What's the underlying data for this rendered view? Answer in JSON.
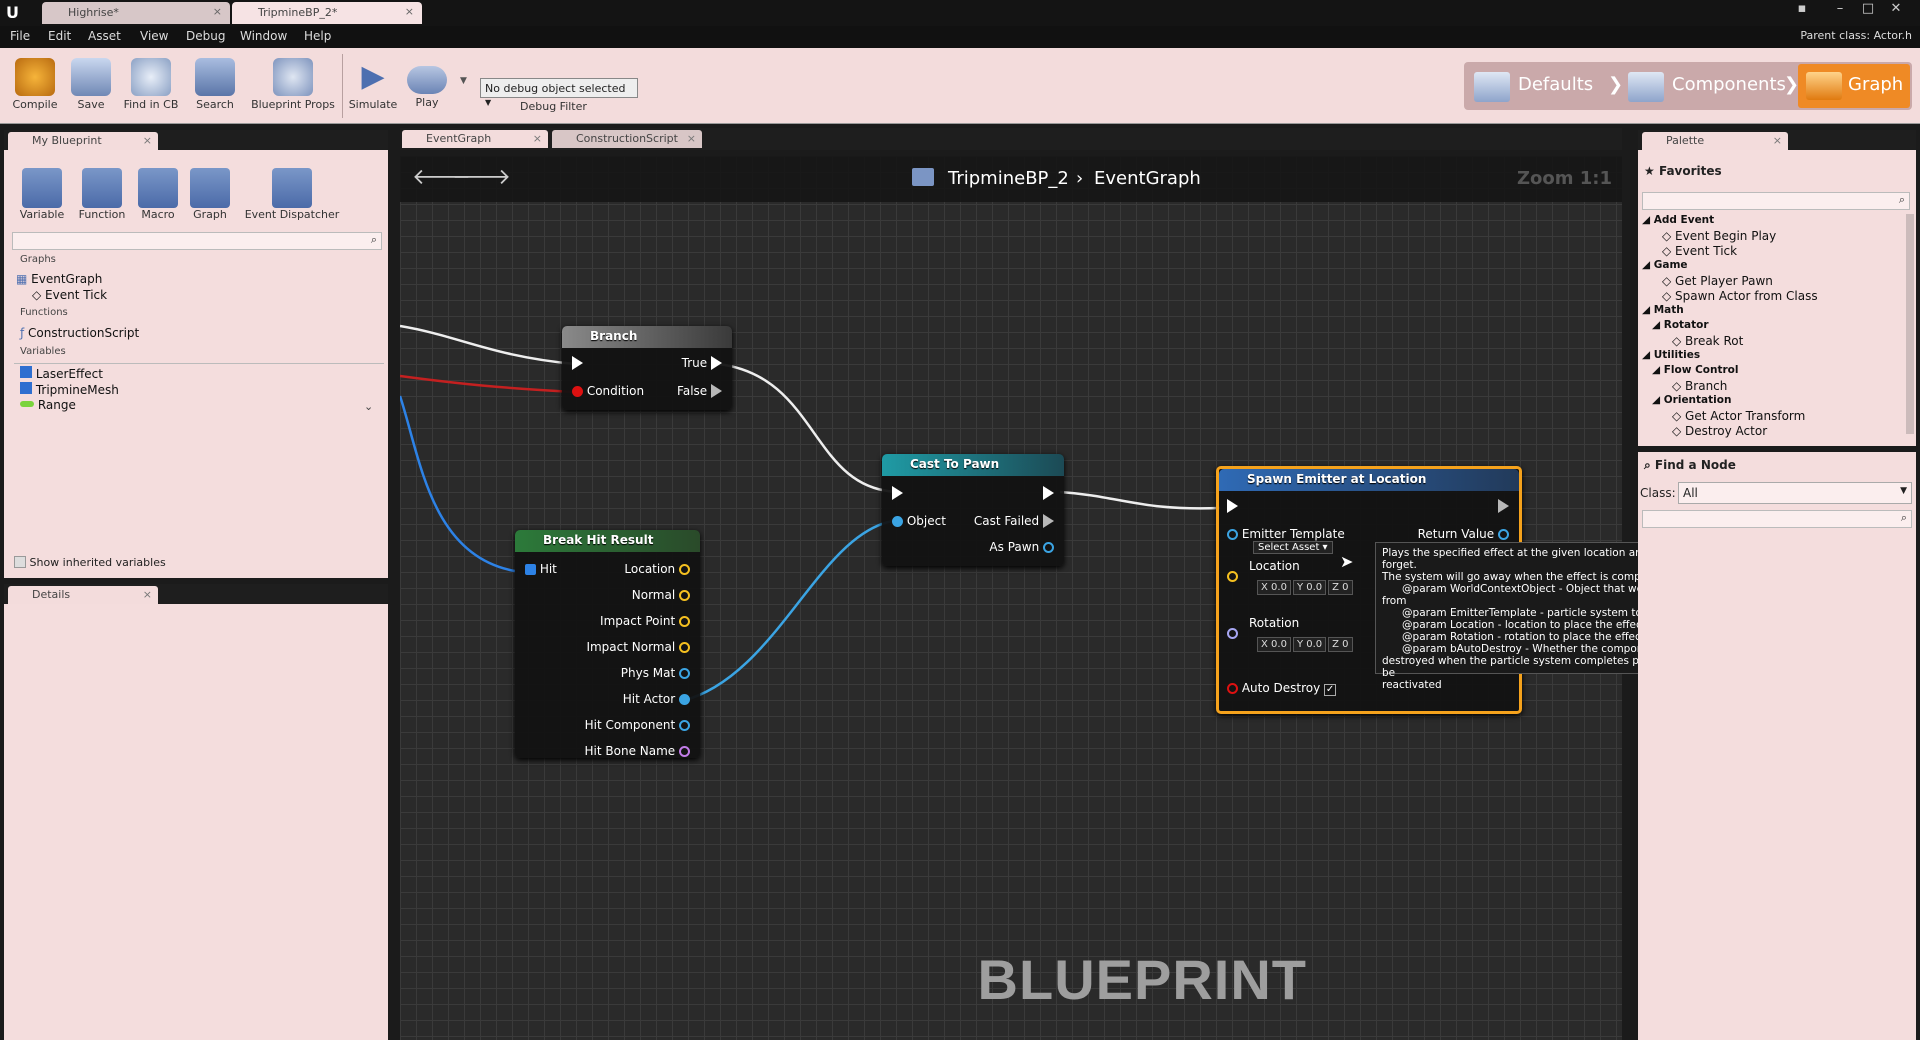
{
  "window": {
    "tabs": [
      {
        "label": "Highrise*"
      },
      {
        "label": "TripmineBP_2*"
      }
    ],
    "parent_class": "Parent class: Actor.h"
  },
  "menu": [
    "File",
    "Edit",
    "Asset",
    "View",
    "Debug",
    "Window",
    "Help"
  ],
  "toolbar": {
    "buttons": [
      {
        "label": "Compile",
        "icon": "compile-icon"
      },
      {
        "label": "Save",
        "icon": "save-icon"
      },
      {
        "label": "Find in CB",
        "icon": "find-icon"
      },
      {
        "label": "Search",
        "icon": "search-icon"
      },
      {
        "label": "Blueprint Props",
        "icon": "gear-icon"
      },
      {
        "label": "Simulate",
        "icon": "play-icon"
      },
      {
        "label": "Play",
        "icon": "gamepad-icon"
      }
    ],
    "debug_select": "No debug object selected",
    "debug_label": "Debug Filter"
  },
  "modes": {
    "defaults": "Defaults",
    "components": "Components",
    "graph": "Graph"
  },
  "my_blueprint": {
    "tab": "My Blueprint",
    "add_buttons": [
      "Variable",
      "Function",
      "Macro",
      "Graph",
      "Event Dispatcher"
    ],
    "sections": {
      "graphs": "Graphs",
      "functions": "Functions",
      "variables": "Variables"
    },
    "graphs": [
      "EventGraph",
      "Event Tick"
    ],
    "functions": [
      "ConstructionScript"
    ],
    "variables": [
      "LaserEffect",
      "TripmineMesh",
      "Range"
    ],
    "show_inherited": "Show inherited variables"
  },
  "details": {
    "tab": "Details"
  },
  "doc_tabs": [
    "EventGraph",
    "ConstructionScript"
  ],
  "breadcrumb": {
    "blueprint": "TripmineBP_2",
    "graph": "EventGraph",
    "zoom": "Zoom 1:1"
  },
  "nodes": {
    "branch": {
      "title": "Branch",
      "pins": [
        "True",
        "Condition",
        "False"
      ]
    },
    "break_hit": {
      "title": "Break Hit Result",
      "in": "Hit",
      "outs": [
        "Location",
        "Normal",
        "Impact Point",
        "Impact Normal",
        "Phys Mat",
        "Hit Actor",
        "Hit Component",
        "Hit Bone Name"
      ]
    },
    "cast": {
      "title": "Cast To Pawn",
      "object": "Object",
      "failed": "Cast Failed",
      "as_pawn": "As Pawn"
    },
    "spawn": {
      "title": "Spawn Emitter at Location",
      "emitter": "Emitter Template",
      "select_asset": "Select Asset",
      "return_value": "Return Value",
      "location": "Location",
      "rotation": "Rotation",
      "auto_destroy": "Auto Destroy",
      "vec_x": "X 0.0",
      "vec_y": "Y 0.0",
      "vec_z": "Z 0"
    }
  },
  "tooltip": [
    "Plays the specified effect at the given location and rotation, fire and forget.",
    "The system will go away when the effect is complete. Does not replicate.",
    "      @param WorldContextObject - Object that we can obtain a world context",
    "from",
    "      @param EmitterTemplate - particle system to create",
    "      @param Location - location to place the effect in world space",
    "      @param Rotation - rotation to place the effect in world space",
    "      @param bAutoDestroy - Whether the component will automatically be",
    "destroyed when the particle system completes playing or whether it can be",
    "reactivated"
  ],
  "palette": {
    "tab": "Palette",
    "favorites": "Favorites",
    "tree": [
      {
        "t": "Add Event",
        "lvl": 0,
        "cat": true
      },
      {
        "t": "Event Begin Play",
        "lvl": 2
      },
      {
        "t": "Event Tick",
        "lvl": 2
      },
      {
        "t": "Game",
        "lvl": 0,
        "cat": true
      },
      {
        "t": "Get Player Pawn",
        "lvl": 2
      },
      {
        "t": "Spawn Actor from Class",
        "lvl": 2
      },
      {
        "t": "Math",
        "lvl": 0,
        "cat": true
      },
      {
        "t": "Rotator",
        "lvl": 1,
        "cat": true
      },
      {
        "t": "Break Rot",
        "lvl": 3
      },
      {
        "t": "Utilities",
        "lvl": 0,
        "cat": true
      },
      {
        "t": "Flow Control",
        "lvl": 1,
        "cat": true
      },
      {
        "t": "Branch",
        "lvl": 3
      },
      {
        "t": "Orientation",
        "lvl": 1,
        "cat": true
      },
      {
        "t": "Get Actor Transform",
        "lvl": 3
      },
      {
        "t": "Destroy Actor",
        "lvl": 3
      }
    ],
    "find_node": "Find a Node",
    "class_label": "Class:",
    "class_value": "All"
  },
  "watermark": "BLUEPRINT"
}
